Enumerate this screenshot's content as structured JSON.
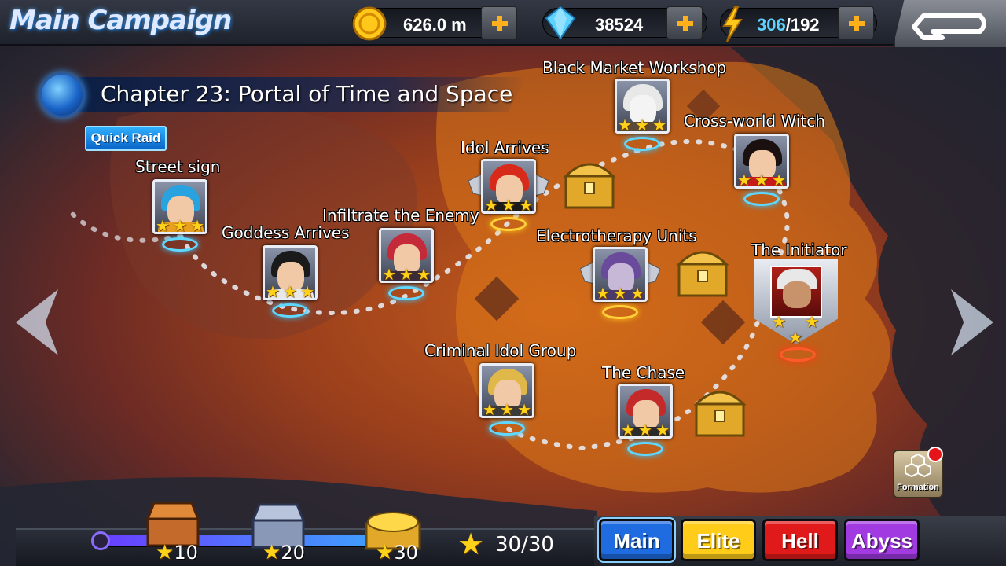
{
  "header": {
    "title": "Main Campaign",
    "gold": "626.0 m",
    "diamonds": "38524",
    "stamina_current": "306",
    "stamina_max": "/192"
  },
  "chapter": {
    "title": "Chapter 23: Portal of Time and Space",
    "quick_raid_label": "Quick Raid"
  },
  "stages": [
    {
      "name": "Street sign",
      "stars": 3
    },
    {
      "name": "Goddess Arrives",
      "stars": 3
    },
    {
      "name": "Infiltrate the Enemy",
      "stars": 3
    },
    {
      "name": "Idol Arrives",
      "stars": 3
    },
    {
      "name": "Black Market Workshop",
      "stars": 3
    },
    {
      "name": "Cross-world Witch",
      "stars": 3
    },
    {
      "name": "Electrotherapy Units",
      "stars": 3
    },
    {
      "name": "Criminal Idol Group",
      "stars": 3
    },
    {
      "name": "The Chase",
      "stars": 3
    },
    {
      "name": "The Initiator",
      "stars": 3
    }
  ],
  "formation_label": "Formation",
  "rewards": {
    "milestones": [
      "10",
      "20",
      "30"
    ],
    "progress_fraction": 1.0,
    "total_stars": "30/30"
  },
  "modes": [
    "Main",
    "Elite",
    "Hell",
    "Abyss"
  ],
  "colors": {
    "main_tab": "#1f6be0",
    "elite_tab": "#ffcc1a",
    "hell_tab": "#e01a1a",
    "abyss_tab": "#a13ae0",
    "star": "#ffd21a"
  }
}
